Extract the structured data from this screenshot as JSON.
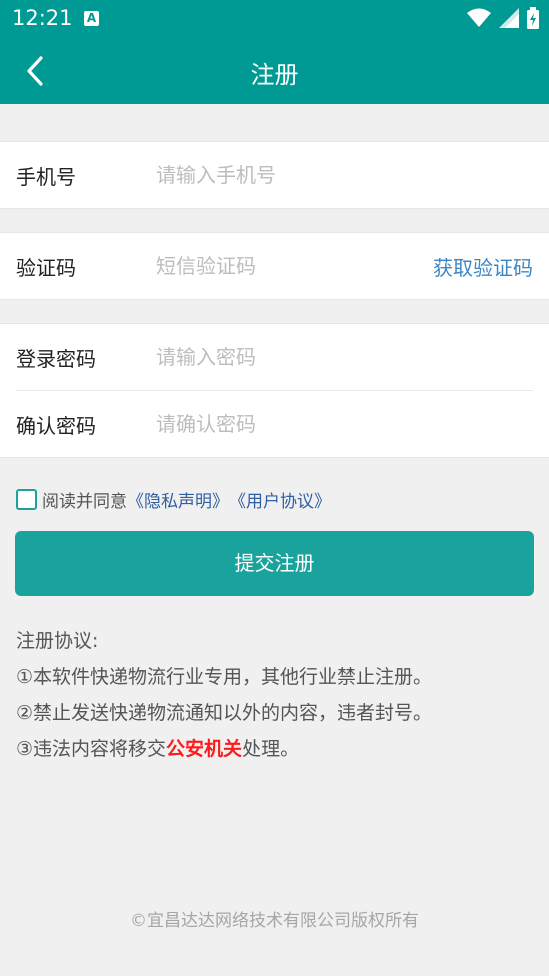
{
  "status_bar": {
    "time": "12:21",
    "notification_icon_letter": "A"
  },
  "app_bar": {
    "title": "注册"
  },
  "form": {
    "phone": {
      "label": "手机号",
      "placeholder": "请输入手机号",
      "value": ""
    },
    "code": {
      "label": "验证码",
      "placeholder": "短信验证码",
      "value": "",
      "get_code_label": "获取验证码"
    },
    "password": {
      "label": "登录密码",
      "placeholder": "请输入密码",
      "value": ""
    },
    "confirm_password": {
      "label": "确认密码",
      "placeholder": "请确认密码",
      "value": ""
    }
  },
  "agreement": {
    "checked": false,
    "prefix": "阅读并同意",
    "privacy_link": "《隐私声明》",
    "user_link": "《用户协议》"
  },
  "submit_label": "提交注册",
  "notes": {
    "title": "注册协议:",
    "item1": "①本软件快递物流行业专用，其他行业禁止注册。",
    "item2": "②禁止发送快递物流通知以外的内容，违者封号。",
    "item3_before": "③违法内容将移交",
    "item3_highlight": "公安机关",
    "item3_after": "处理。"
  },
  "footer": "©宜昌达达网络技术有限公司版权所有",
  "colors": {
    "primary": "#009a95",
    "button": "#1aa39d",
    "link": "#3d86c6",
    "warning": "#ff1a1a"
  },
  "icons": {
    "back": "chevron-left-icon",
    "wifi": "wifi-icon",
    "signal": "signal-icon",
    "battery": "battery-icon"
  }
}
